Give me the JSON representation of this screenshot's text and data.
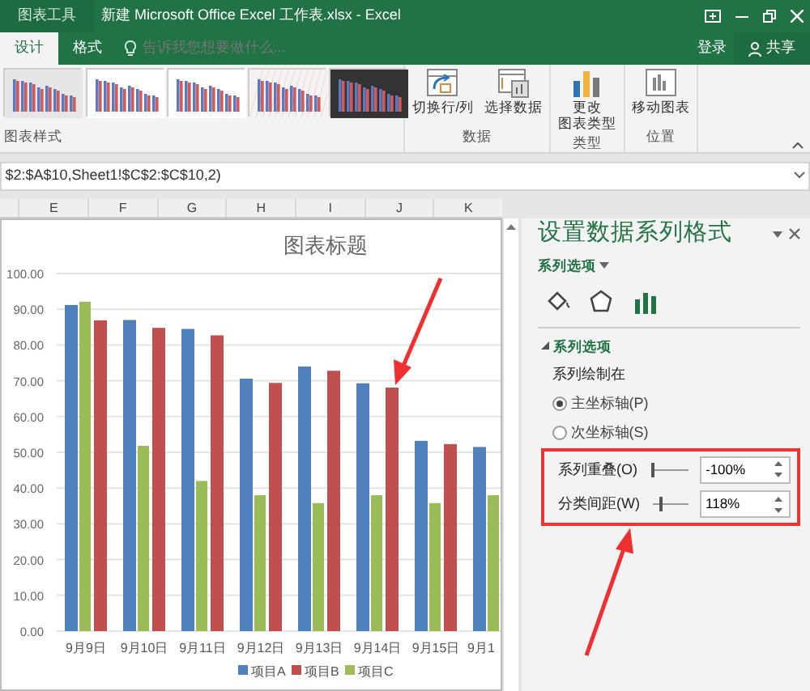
{
  "app": {
    "context_tab": "图表工具",
    "title": "新建 Microsoft Office Excel 工作表.xlsx - Excel"
  },
  "tabs": [
    {
      "label": "设计",
      "selected": true
    },
    {
      "label": "格式",
      "selected": false
    }
  ],
  "tell_me": {
    "placeholder": "告诉我您想要做什么..."
  },
  "account": {
    "sign_in": "登录",
    "share": "共享"
  },
  "ribbon": {
    "gallery_label": "图表样式",
    "styles": [
      {
        "kind": "gradient"
      },
      {
        "kind": "plain"
      },
      {
        "kind": "plain"
      },
      {
        "kind": "hatched"
      },
      {
        "kind": "dark"
      }
    ],
    "groups": [
      {
        "label": "数据",
        "buttons": [
          {
            "kind": "switch",
            "lines": [
              "切换行/列"
            ]
          },
          {
            "kind": "select",
            "lines": [
              "选择数据"
            ]
          }
        ]
      },
      {
        "label": "类型",
        "buttons": [
          {
            "kind": "type",
            "lines": [
              "更改",
              "图表类型"
            ]
          }
        ]
      },
      {
        "label": "位置",
        "buttons": [
          {
            "kind": "move",
            "lines": [
              "移动图表"
            ]
          }
        ]
      }
    ]
  },
  "formula": "$2:$A$10,Sheet1!$C$2:$C$10,2)",
  "columns": [
    "E",
    "F",
    "G",
    "H",
    "I",
    "J",
    "K"
  ],
  "chart": {
    "chart_data": {
      "type": "bar",
      "title": "图表标题",
      "categories": [
        "9月9日",
        "9月10日",
        "9月11日",
        "9月12日",
        "9月13日",
        "9月14日",
        "9月15日",
        "9月1"
      ],
      "series": [
        {
          "name": "项目A",
          "color": "#4f81bd",
          "values": [
            91.2,
            87,
            84.5,
            70.6,
            74,
            69.3,
            53.2,
            51.5
          ]
        },
        {
          "name": "项目B",
          "color": "#c0504d",
          "values": [
            86.9,
            84.8,
            82.7,
            69.4,
            72.8,
            68.1,
            52.3,
            null
          ]
        },
        {
          "name": "项目C",
          "color": "#9bbb59",
          "values": [
            92.1,
            51.8,
            42,
            38,
            35.8,
            38,
            35.8,
            38
          ]
        }
      ],
      "grid": true,
      "legend": true,
      "ylim": [
        0,
        100
      ],
      "yticks": [
        {
          "value": 0,
          "label": "0.00"
        },
        {
          "value": 10,
          "label": "10.00"
        },
        {
          "value": 20,
          "label": "20.00"
        },
        {
          "value": 30,
          "label": "30.00"
        },
        {
          "value": 40,
          "label": "40.00"
        },
        {
          "value": 50,
          "label": "50.00"
        },
        {
          "value": 60,
          "label": "60.00"
        },
        {
          "value": 70,
          "label": "70.00"
        },
        {
          "value": 80,
          "label": "80.00"
        },
        {
          "value": 90,
          "label": "90.00"
        },
        {
          "value": 100,
          "label": "100.00"
        }
      ]
    }
  },
  "pane": {
    "title": "设置数据系列格式",
    "subtitle": "系列选项",
    "icon_tabs": [
      {
        "kind": "fill",
        "selected": false
      },
      {
        "kind": "effects",
        "selected": false
      },
      {
        "kind": "series",
        "selected": true
      }
    ],
    "section": {
      "label": "系列选项",
      "expanded": true
    },
    "plot_on_label": "系列绘制在",
    "radios": [
      {
        "label": "主坐标轴(P)",
        "selected": true
      },
      {
        "label": "次坐标轴(S)",
        "selected": false
      }
    ],
    "options": [
      {
        "label": "系列重叠(O)",
        "level": 0,
        "value": "-100%"
      },
      {
        "label": "分类间距(W)",
        "level": 0.236,
        "value": "118%"
      }
    ]
  }
}
